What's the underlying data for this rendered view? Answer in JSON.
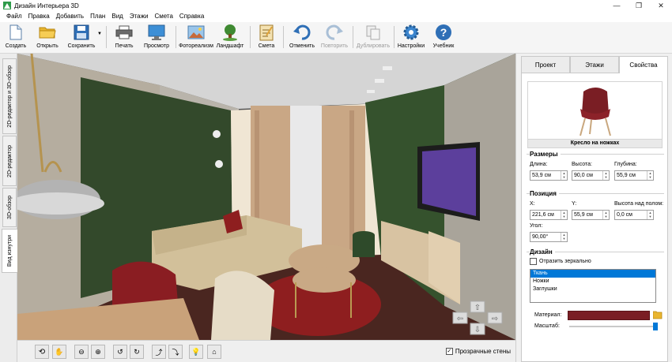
{
  "window": {
    "title": "Дизайн Интерьера 3D",
    "minimize": "—",
    "maximize": "❐",
    "close": "✕"
  },
  "menu": [
    "Файл",
    "Правка",
    "Добавить",
    "План",
    "Вид",
    "Этажи",
    "Смета",
    "Справка"
  ],
  "toolbar": {
    "create": "Создать",
    "open": "Открыть",
    "save": "Сохранить",
    "print": "Печать",
    "preview": "Просмотр",
    "photoreal": "Фотореализм",
    "landscape": "Ландшафт",
    "estimate": "Смета",
    "undo": "Отменить",
    "redo": "Повторить",
    "duplicate": "Дублировать",
    "settings": "Настройки",
    "tutorial": "Учебник"
  },
  "left_tabs": [
    "2D-редактор и 3D-обзор",
    "2D-редактор",
    "3D-обзор",
    "Вид изнутри"
  ],
  "bottom": {
    "transparent_walls": "Прозрачные стены",
    "transparent_checked": true
  },
  "right_tabs": [
    "Проект",
    "Этажи",
    "Свойства"
  ],
  "object_name": "Кресло на ножках",
  "sizes": {
    "title": "Размеры",
    "length_label": "Длина:",
    "length": "53,9 см",
    "height_label": "Высота:",
    "height": "90,0 см",
    "depth_label": "Глубина:",
    "depth": "55,9 см"
  },
  "position": {
    "title": "Позиция",
    "x_label": "X:",
    "x": "221,6 см",
    "y_label": "Y:",
    "y": "55,9 см",
    "elev_label": "Высота над полом:",
    "elev": "0,0 см",
    "angle_label": "Угол:",
    "angle": "90,00°"
  },
  "design": {
    "title": "Дизайн",
    "mirror": "Отразить зеркально",
    "parts": [
      "Ткань",
      "Ножки",
      "Заглушки"
    ],
    "selected": 0,
    "material_label": "Материал:",
    "scale_label": "Масштаб:",
    "material_color": "#7a1e24"
  }
}
